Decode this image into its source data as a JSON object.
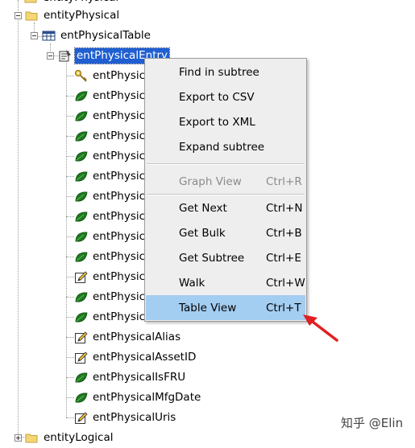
{
  "tree": {
    "top_partial": "entityPhysical",
    "entity_physical": "entityPhysical",
    "table": "entPhysicalTable",
    "entry": "entPhysicalEntry",
    "children": [
      {
        "label": "entPhysica",
        "icon": "key-icon"
      },
      {
        "label": "entPhysica",
        "icon": "leaf-icon"
      },
      {
        "label": "entPhysica",
        "icon": "leaf-icon"
      },
      {
        "label": "entPhysica",
        "icon": "leaf-icon"
      },
      {
        "label": "entPhysica",
        "icon": "leaf-icon"
      },
      {
        "label": "entPhysica",
        "icon": "leaf-icon"
      },
      {
        "label": "entPhysica",
        "icon": "leaf-icon"
      },
      {
        "label": "entPhysica",
        "icon": "leaf-icon"
      },
      {
        "label": "entPhysica",
        "icon": "leaf-icon"
      },
      {
        "label": "entPhysica",
        "icon": "leaf-icon"
      },
      {
        "label": "entPhysica",
        "icon": "pencil-icon"
      },
      {
        "label": "entPhysica",
        "icon": "leaf-icon"
      },
      {
        "label": "entPhysica",
        "icon": "leaf-icon"
      },
      {
        "label": "entPhysicalAlias",
        "icon": "pencil-icon"
      },
      {
        "label": "entPhysicalAssetID",
        "icon": "pencil-icon"
      },
      {
        "label": "entPhysicalIsFRU",
        "icon": "leaf-icon"
      },
      {
        "label": "entPhysicalMfgDate",
        "icon": "leaf-icon"
      },
      {
        "label": "entPhysicalUris",
        "icon": "pencil-icon"
      }
    ],
    "entity_logical": "entityLogical"
  },
  "context_menu": {
    "group1": [
      {
        "label": "Find in subtree",
        "shortcut": ""
      },
      {
        "label": "Export to CSV",
        "shortcut": ""
      },
      {
        "label": "Export to XML",
        "shortcut": ""
      },
      {
        "label": "Expand subtree",
        "shortcut": ""
      }
    ],
    "group2": [
      {
        "label": "Graph View",
        "shortcut": "Ctrl+R"
      }
    ],
    "group3": [
      {
        "label": "Get Next",
        "shortcut": "Ctrl+N"
      },
      {
        "label": "Get Bulk",
        "shortcut": "Ctrl+B"
      },
      {
        "label": "Get Subtree",
        "shortcut": "Ctrl+E"
      },
      {
        "label": "Walk",
        "shortcut": "Ctrl+W"
      },
      {
        "label": "Table View",
        "shortcut": "Ctrl+T"
      }
    ]
  },
  "watermark": "知乎 @Elin",
  "colors": {
    "selection": "#1f5fd1",
    "menu_bg": "#eeeeee",
    "menu_highlight": "#a4cdf2",
    "arrow": "#e02020",
    "leaf": "#1e7a1e",
    "folder": "#f3d777"
  }
}
